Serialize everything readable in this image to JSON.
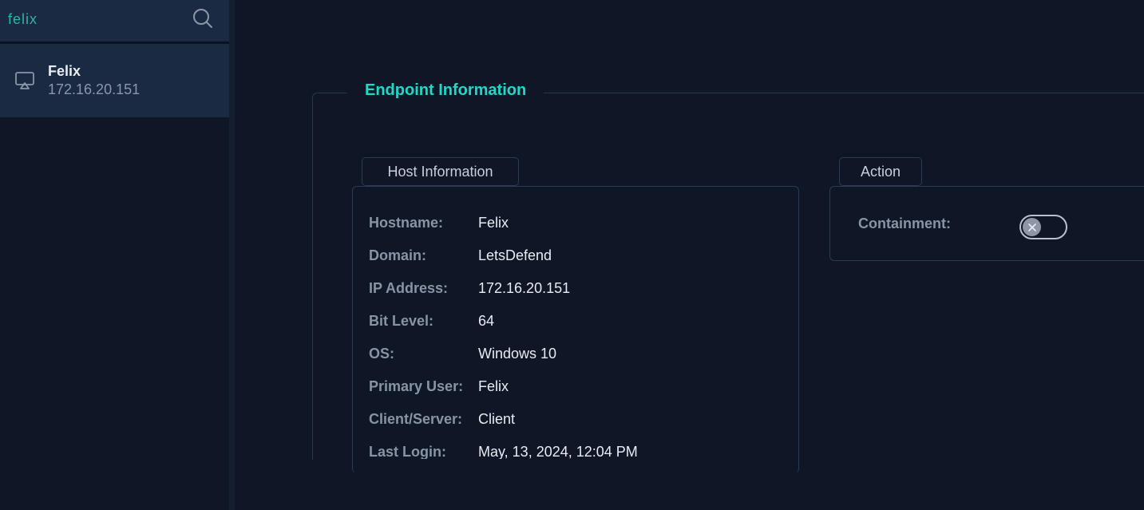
{
  "search": {
    "value": "felix"
  },
  "sidebar": {
    "items": [
      {
        "name": "Felix",
        "ip": "172.16.20.151"
      }
    ]
  },
  "main": {
    "section_title": "Endpoint Information",
    "host_tab_label": "Host Information",
    "action_tab_label": "Action",
    "host_info": [
      {
        "label": "Hostname:",
        "value": "Felix"
      },
      {
        "label": "Domain:",
        "value": "LetsDefend"
      },
      {
        "label": "IP Address:",
        "value": "172.16.20.151"
      },
      {
        "label": "Bit Level:",
        "value": "64"
      },
      {
        "label": "OS:",
        "value": "Windows 10"
      },
      {
        "label": "Primary User:",
        "value": "Felix"
      },
      {
        "label": "Client/Server:",
        "value": "Client"
      },
      {
        "label": "Last Login:",
        "value": "May, 13, 2024, 12:04 PM"
      }
    ],
    "action": {
      "containment_label": "Containment:",
      "containment_enabled": false
    }
  },
  "colors": {
    "accent": "#1fd8c8",
    "background": "#0f1726",
    "sidebar_item": "#1b2a43"
  }
}
